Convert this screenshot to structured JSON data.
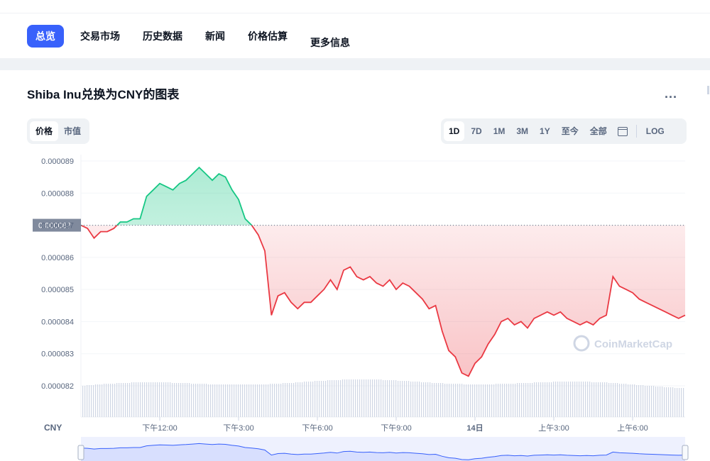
{
  "tabs": [
    {
      "label": "总览",
      "active": true
    },
    {
      "label": "交易市场",
      "active": false
    },
    {
      "label": "历史数据",
      "active": false
    },
    {
      "label": "新闻",
      "active": false
    },
    {
      "label": "价格估算",
      "active": false
    },
    {
      "label": "更多信息",
      "active": false
    }
  ],
  "chart_title": "Shiba Inu兑换为CNY的图表",
  "more_label": "...",
  "toggle": {
    "price": "价格",
    "market_cap": "市值"
  },
  "ranges": {
    "d1": "1D",
    "d7": "7D",
    "m1": "1M",
    "m3": "3M",
    "y1": "1Y",
    "ytd": "至今",
    "all": "全部",
    "log": "LOG"
  },
  "watermark": "CoinMarketCap",
  "colors": {
    "up": "#16c784",
    "down": "#ea3943",
    "accent": "#3861fb",
    "volume": "#cfd6e4"
  },
  "chart_data": {
    "type": "area",
    "baseline": 8.7e-05,
    "baseline_label": "0.000087",
    "currency": "CNY",
    "ylim": [
      8.15e-05,
      8.91e-05
    ],
    "y_ticks": [
      "0.000089",
      "0.000088",
      "0.000087",
      "0.000086",
      "0.000085",
      "0.000084",
      "0.000083",
      "0.000082"
    ],
    "x_ticks": [
      "下午12:00",
      "下午3:00",
      "下午6:00",
      "下午9:00",
      "14日",
      "上午3:00",
      "上午6:00"
    ],
    "x_hours": [
      10,
      12,
      15,
      18,
      21,
      24,
      27,
      30
    ],
    "series": [
      {
        "x_hours": [
          9.0,
          9.25,
          9.5,
          9.75,
          10.0,
          10.25,
          10.5,
          10.75,
          11.0,
          11.25,
          11.5,
          11.75,
          12.0,
          12.25,
          12.5,
          12.75,
          13.0,
          13.25,
          13.5,
          13.75,
          14.0,
          14.25,
          14.5,
          14.75,
          15.0,
          15.25,
          15.5,
          15.75,
          16.0,
          16.25,
          16.5,
          16.75,
          17.0,
          17.25,
          17.5,
          17.75,
          18.0,
          18.25,
          18.5,
          18.75,
          19.0,
          19.25,
          19.5,
          19.75,
          20.0,
          20.25,
          20.5,
          20.75,
          21.0,
          21.25,
          21.5,
          21.75,
          22.0,
          22.25,
          22.5,
          22.75,
          23.0,
          23.25,
          23.5,
          23.75,
          24.0,
          24.25,
          24.5,
          24.75,
          25.0,
          25.25,
          25.5,
          25.75,
          26.0,
          26.25,
          26.5,
          26.75,
          27.0,
          27.25,
          27.5,
          27.75,
          28.0,
          28.25,
          28.5,
          28.75,
          29.0,
          29.25,
          29.5,
          29.75,
          30.0,
          30.25,
          30.5,
          30.75,
          31.0,
          31.25,
          31.5,
          31.75,
          32.0
        ],
        "values": [
          8.7e-05,
          8.69e-05,
          8.66e-05,
          8.68e-05,
          8.68e-05,
          8.69e-05,
          8.71e-05,
          8.71e-05,
          8.72e-05,
          8.72e-05,
          8.79e-05,
          8.81e-05,
          8.83e-05,
          8.82e-05,
          8.81e-05,
          8.83e-05,
          8.84e-05,
          8.86e-05,
          8.88e-05,
          8.86e-05,
          8.84e-05,
          8.86e-05,
          8.85e-05,
          8.81e-05,
          8.78e-05,
          8.72e-05,
          8.7e-05,
          8.67e-05,
          8.62e-05,
          8.42e-05,
          8.48e-05,
          8.49e-05,
          8.46e-05,
          8.44e-05,
          8.46e-05,
          8.46e-05,
          8.48e-05,
          8.5e-05,
          8.53e-05,
          8.5e-05,
          8.56e-05,
          8.57e-05,
          8.54e-05,
          8.53e-05,
          8.54e-05,
          8.52e-05,
          8.51e-05,
          8.53e-05,
          8.5e-05,
          8.52e-05,
          8.51e-05,
          8.49e-05,
          8.47e-05,
          8.44e-05,
          8.45e-05,
          8.37e-05,
          8.31e-05,
          8.29e-05,
          8.24e-05,
          8.23e-05,
          8.27e-05,
          8.29e-05,
          8.33e-05,
          8.36e-05,
          8.4e-05,
          8.41e-05,
          8.39e-05,
          8.4e-05,
          8.38e-05,
          8.41e-05,
          8.42e-05,
          8.43e-05,
          8.42e-05,
          8.43e-05,
          8.41e-05,
          8.4e-05,
          8.39e-05,
          8.4e-05,
          8.39e-05,
          8.41e-05,
          8.42e-05,
          8.54e-05,
          8.51e-05,
          8.5e-05,
          8.49e-05,
          8.47e-05,
          8.46e-05,
          8.45e-05,
          8.44e-05,
          8.43e-05,
          8.42e-05,
          8.41e-05,
          8.42e-05
        ]
      }
    ]
  }
}
